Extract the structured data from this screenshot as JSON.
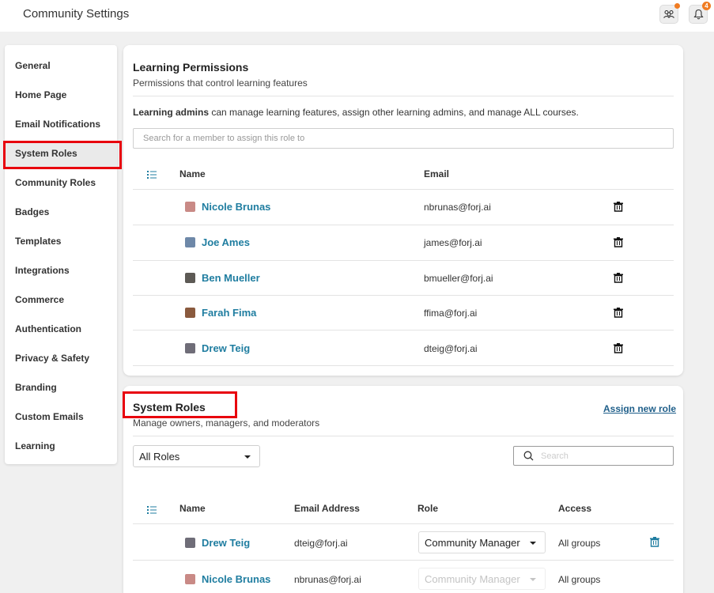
{
  "app": {
    "title": "Community Settings",
    "notification_count": "4"
  },
  "sidebar": {
    "items": [
      {
        "label": "General"
      },
      {
        "label": "Home Page"
      },
      {
        "label": "Email Notifications"
      },
      {
        "label": "System Roles"
      },
      {
        "label": "Community Roles"
      },
      {
        "label": "Badges"
      },
      {
        "label": "Templates"
      },
      {
        "label": "Integrations"
      },
      {
        "label": "Commerce"
      },
      {
        "label": "Authentication"
      },
      {
        "label": "Privacy & Safety"
      },
      {
        "label": "Branding"
      },
      {
        "label": "Custom Emails"
      },
      {
        "label": "Learning"
      }
    ],
    "active": "System Roles"
  },
  "learning": {
    "title": "Learning Permissions",
    "subtitle": "Permissions that control learning features",
    "desc_bold": "Learning admins",
    "desc_rest": " can manage learning features, assign other learning admins, and manage ALL courses.",
    "search_placeholder": "Search for a member to assign this role to",
    "columns": {
      "name": "Name",
      "email": "Email"
    },
    "rows": [
      {
        "name": "Nicole Brunas",
        "email": "nbrunas@forj.ai"
      },
      {
        "name": "Joe Ames",
        "email": "james@forj.ai"
      },
      {
        "name": "Ben Mueller",
        "email": "bmueller@forj.ai"
      },
      {
        "name": "Farah Fima",
        "email": "ffima@forj.ai"
      },
      {
        "name": "Drew Teig",
        "email": "dteig@forj.ai"
      }
    ]
  },
  "roles": {
    "title": "System Roles",
    "subtitle": "Manage owners, managers, and moderators",
    "assign_link": "Assign new role",
    "filter_value": "All Roles",
    "search_placeholder": "Search",
    "columns": {
      "name": "Name",
      "email": "Email Address",
      "role": "Role",
      "access": "Access"
    },
    "rows": [
      {
        "name": "Drew Teig",
        "email": "dteig@forj.ai",
        "role": "Community Manager",
        "access": "All groups"
      },
      {
        "name": "Nicole Brunas",
        "email": "nbrunas@forj.ai",
        "role": "Community Manager",
        "access": "All groups"
      }
    ]
  },
  "colors": {
    "accent": "#1f7da0",
    "highlight": "#e8000d",
    "badge": "#f07c22"
  }
}
